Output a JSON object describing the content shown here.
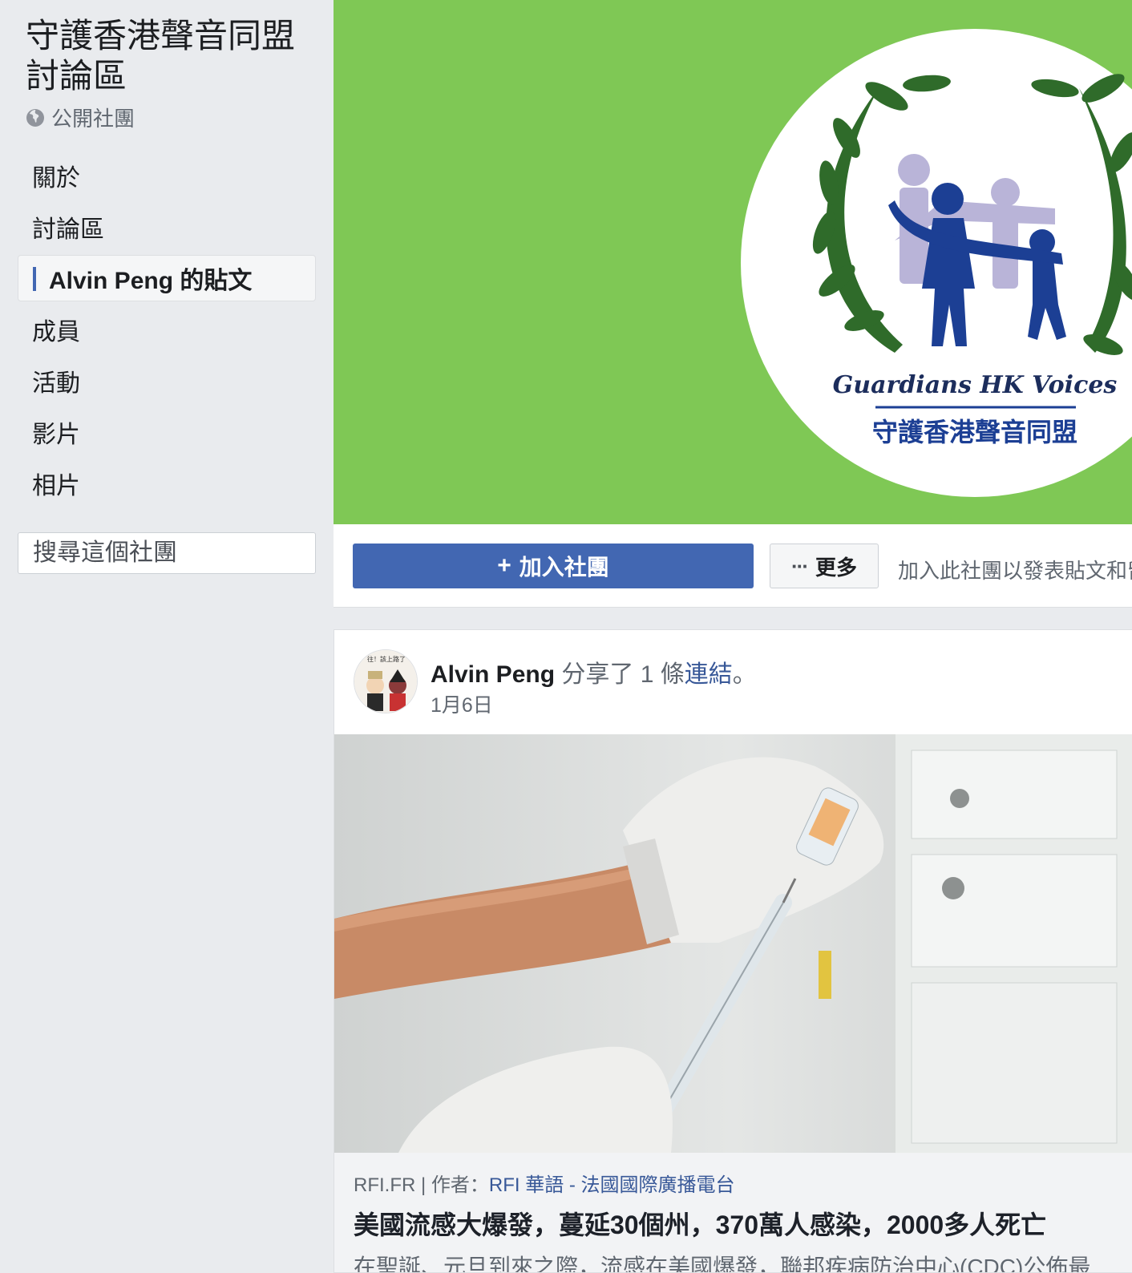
{
  "group": {
    "title": "守護香港聲音同盟討論區",
    "privacy": "公開社團"
  },
  "nav": {
    "items": [
      {
        "label": "關於"
      },
      {
        "label": "討論區"
      },
      {
        "label": "Alvin Peng 的貼文",
        "active": true
      },
      {
        "label": "成員"
      },
      {
        "label": "活動"
      },
      {
        "label": "影片"
      },
      {
        "label": "相片"
      }
    ]
  },
  "search": {
    "placeholder": "搜尋這個社團"
  },
  "cover": {
    "logo_english": "Guardians HK Voices",
    "logo_chinese": "守護香港聲音同盟",
    "bg_color": "#7fc855"
  },
  "actions": {
    "join_label": "加入社團",
    "more_label": "更多",
    "join_hint": "加入此社團以發表貼文和留言"
  },
  "post": {
    "author": "Alvin Peng",
    "action_text": " 分享了 1 條",
    "link_word": "連結",
    "end_punct": "。",
    "date": "1月6日",
    "link": {
      "domain": "RFI.FR",
      "author_prefix": "作者：",
      "author": "RFI 華語 - 法國國際廣播電台",
      "title": "美國流感大爆發，蔓延30個州，370萬人感染，2000多人死亡",
      "description": "在聖誕、元旦到來之際，流感在美國爆發，聯邦疾病防治中心(CDC)公佈最新數據"
    }
  },
  "colors": {
    "accent": "#4267b2",
    "link": "#385898",
    "page_bg": "#e9ebee"
  }
}
